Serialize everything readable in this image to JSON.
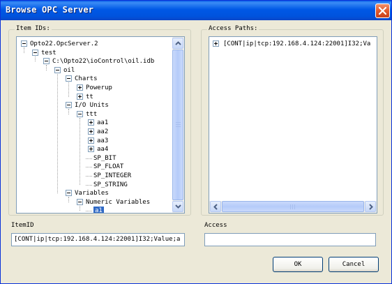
{
  "window": {
    "title": "Browse OPC Server"
  },
  "item_ids": {
    "legend": "Item IDs:",
    "tree": [
      {
        "label": "Opto22.OpcServer.2",
        "level": 0,
        "expander": "minus"
      },
      {
        "label": "test",
        "level": 1,
        "expander": "minus"
      },
      {
        "label": "C:\\Opto22\\ioControl\\oil.idb",
        "level": 2,
        "expander": "minus"
      },
      {
        "label": "oil",
        "level": 3,
        "expander": "minus"
      },
      {
        "label": "Charts",
        "level": 4,
        "expander": "minus"
      },
      {
        "label": "Powerup",
        "level": 5,
        "expander": "plus"
      },
      {
        "label": "tt",
        "level": 5,
        "expander": "plus"
      },
      {
        "label": "I/O Units",
        "level": 4,
        "expander": "minus"
      },
      {
        "label": "ttt",
        "level": 5,
        "expander": "minus"
      },
      {
        "label": "aa1",
        "level": 6,
        "expander": "plus"
      },
      {
        "label": "aa2",
        "level": 6,
        "expander": "plus"
      },
      {
        "label": "aa3",
        "level": 6,
        "expander": "plus"
      },
      {
        "label": "aa4",
        "level": 6,
        "expander": "plus"
      },
      {
        "label": "SP_BIT",
        "level": 6,
        "expander": "none"
      },
      {
        "label": "SP_FLOAT",
        "level": 6,
        "expander": "none"
      },
      {
        "label": "SP_INTEGER",
        "level": 6,
        "expander": "none"
      },
      {
        "label": "SP_STRING",
        "level": 6,
        "expander": "none"
      },
      {
        "label": "Variables",
        "level": 4,
        "expander": "minus"
      },
      {
        "label": "Numeric Variables",
        "level": 5,
        "expander": "minus"
      },
      {
        "label": "a1",
        "level": 6,
        "expander": "none",
        "selected": true
      }
    ]
  },
  "access_paths": {
    "legend": "Access Paths:",
    "items": [
      {
        "label": "[CONT|ip|tcp:192.168.4.124:22001]I32;Va",
        "expander": "plus"
      }
    ]
  },
  "item_id_field": {
    "label": "ItemID",
    "value": "[CONT|ip|tcp:192.168.4.124:22001]I32;Value;a"
  },
  "access_field": {
    "label": "Access",
    "value": ""
  },
  "buttons": {
    "ok": "OK",
    "cancel": "Cancel"
  },
  "colors": {
    "titlebar": "#0058e6",
    "selection": "#316ac5",
    "dialog_bg": "#ece9d8"
  },
  "icons": {
    "close": "close-icon"
  }
}
